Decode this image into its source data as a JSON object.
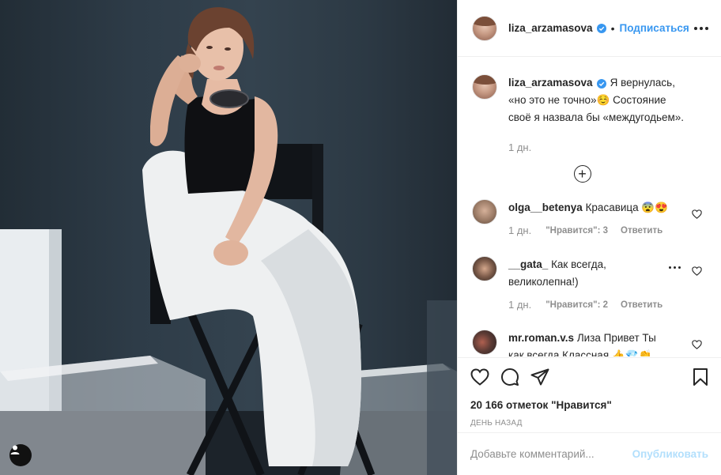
{
  "post": {
    "username": "liza_arzamasova",
    "follow_label": "Подписаться",
    "dot": "•",
    "caption_text": "Я вернулась, «но это не точно»☺️ Состояние своё я назвала бы «междугодьем».",
    "caption_time": "1 дн.",
    "plus_label": "+"
  },
  "comments": [
    {
      "username": "olga__betenya",
      "text": "Красавица 😨😍",
      "time": "1 дн.",
      "likes": "\"Нравится\": 3",
      "reply": "Ответить"
    },
    {
      "username": "__gata_",
      "text": "Как всегда, великолепна!)",
      "time": "1 дн.",
      "likes": "\"Нравится\": 2",
      "reply": "Ответить"
    },
    {
      "username": "mr.roman.v.s",
      "text": "Лиза Привет Ты как всегда Классная.👍💎👏"
    }
  ],
  "actions": {
    "likes_count": "20 166 отметок \"Нравится\"",
    "posted_ago": "ДЕНЬ НАЗАД"
  },
  "composer": {
    "placeholder": "Добавьте комментарий...",
    "publish_label": "Опубликовать"
  },
  "colors": {
    "accent": "#3897f0",
    "publish_disabled": "#b2dffc",
    "muted": "#8e8e8e"
  },
  "icons": [
    "heart-icon",
    "comment-icon",
    "share-icon",
    "bookmark-icon",
    "more-icon",
    "verified-icon",
    "plus-circle-icon",
    "user-tag-icon"
  ]
}
